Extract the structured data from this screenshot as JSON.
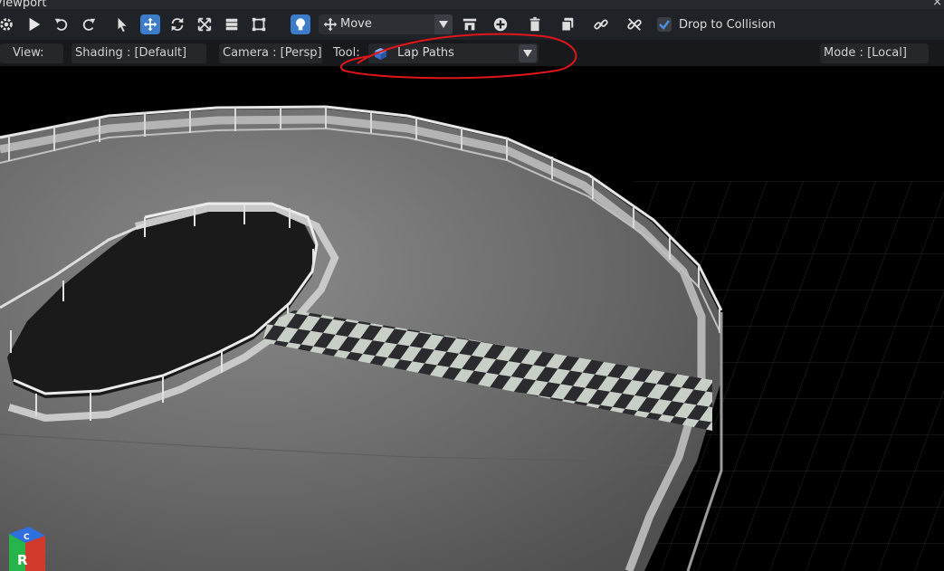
{
  "window": {
    "title": "Viewport",
    "close_glyph": "×"
  },
  "toolbar": {
    "buttons": [
      {
        "icon": "gear-icon"
      },
      {
        "icon": "play-icon"
      },
      {
        "icon": "undo-icon"
      },
      {
        "icon": "redo-icon"
      },
      {
        "icon": "select-cursor-icon"
      },
      {
        "icon": "move-icon",
        "active": true
      },
      {
        "icon": "rotate-icon"
      },
      {
        "icon": "scale-icon"
      },
      {
        "icon": "snap-icon"
      },
      {
        "icon": "bounds-icon"
      },
      {
        "icon": "lightbulb-icon",
        "active": true
      }
    ],
    "transform_mode": "Move",
    "actions": [
      "spawn-icon",
      "add-icon",
      "delete-icon",
      "duplicate-icon",
      "link-icon",
      "unlink-icon"
    ],
    "drop_to_collision": {
      "label": "Drop to Collision",
      "checked": true
    }
  },
  "viewport_bar": {
    "view": "View:",
    "shading": "Shading : [Default]",
    "camera": "Camera : [Persp]",
    "tool_label": "Tool:",
    "tool_value": "Lap Paths",
    "mode": "Mode : [Local]"
  },
  "gizmo": {
    "axis_label": "R",
    "axis_label_top": "C"
  },
  "colors": {
    "accent": "#3d7cc9",
    "annotation": "#e0161b",
    "background": "#000000"
  }
}
